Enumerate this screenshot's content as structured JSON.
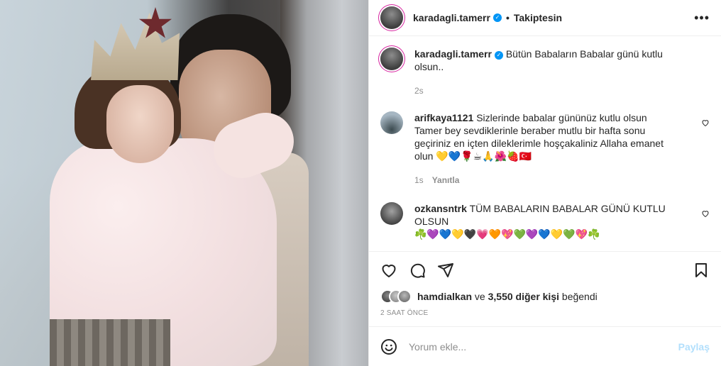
{
  "post": {
    "author": "karadagli.tamerr",
    "follow_status": "Takiptesin",
    "more_label": "•••",
    "caption": {
      "author": "karadagli.tamerr",
      "text": "Bütün Babaların Babalar günü kutlu olsun..",
      "age": "2s"
    },
    "comments": [
      {
        "author": "arifkaya1121",
        "text": "Sizlerinde babalar gününüz kutlu olsun Tamer bey sevdiklerinle beraber mutlu bir hafta sonu geçiriniz en içten dileklerimle hoşçakaliniz Allaha emanet olun 💛💙🌹☕🙏🌺🍓🇹🇷",
        "age": "1s",
        "reply_label": "Yanıtla"
      },
      {
        "author": "ozkansntrk",
        "text": "TÜM BABALARIN BABALAR GÜNÜ KUTLU OLSUN",
        "emojis": "☘️💜💙💛🖤💗🧡💖💚💜💙💛💚💖☘️"
      }
    ],
    "likes": {
      "liker": "hamdialkan",
      "conjunction": "ve",
      "others": "3,550 diğer kişi",
      "suffix": "beğendi"
    },
    "timestamp": "2 saat önce",
    "comment_input": {
      "placeholder": "Yorum ekle...",
      "post_label": "Paylaş"
    }
  },
  "colors": {
    "accent": "#0095f6",
    "post_button_disabled": "#b2dffc",
    "secondary_text": "#8e8e8e",
    "divider": "#efefef"
  },
  "icons": [
    "heart-icon",
    "comment-icon",
    "share-icon",
    "bookmark-icon",
    "emoji-icon",
    "verified-badge-icon",
    "more-options-icon"
  ]
}
